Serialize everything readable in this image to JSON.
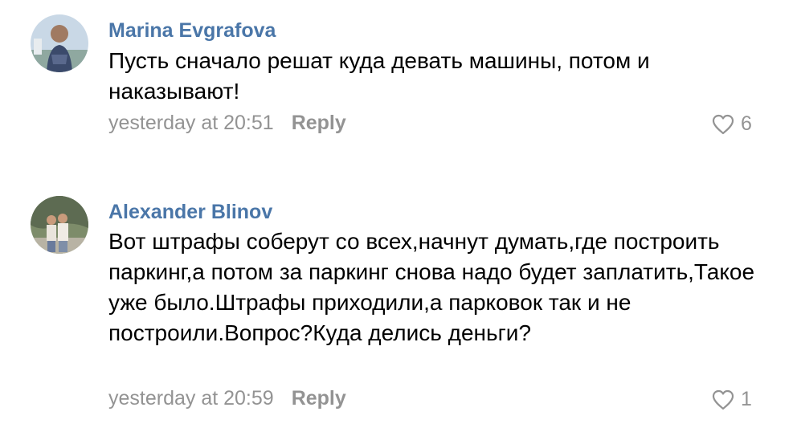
{
  "comments": [
    {
      "author": "Marina Evgrafova",
      "text": "Пусть сначало решат куда девать машины, потом и наказывают!",
      "time": "yesterday at 20:51",
      "reply_label": "Reply",
      "likes": "6",
      "avatar_icon": "user-photo-icon"
    },
    {
      "author": "Alexander Blinov",
      "text": "Вот штрафы соберут со всех,начнут думать,где построить паркинг,а потом за паркинг снова надо будет заплатить,Такое уже было.Штрафы приходили,а парковок так и не построили.Вопрос?Куда делись деньги?",
      "time": "yesterday at 20:59",
      "reply_label": "Reply",
      "likes": "1",
      "avatar_icon": "user-photo-icon"
    }
  ],
  "colors": {
    "author": "#4a76a8",
    "meta": "#939393",
    "text": "#000000"
  },
  "icons": {
    "like": "heart-icon"
  }
}
